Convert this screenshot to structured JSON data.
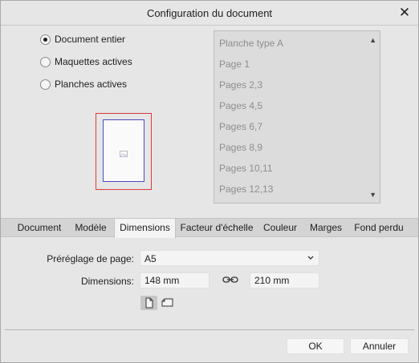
{
  "window": {
    "title": "Configuration du document",
    "close_symbol": "✕"
  },
  "scope": {
    "options": [
      {
        "label": "Document entier",
        "checked": true
      },
      {
        "label": "Maquettes actives",
        "checked": false
      },
      {
        "label": "Planches actives",
        "checked": false
      }
    ]
  },
  "spreads": {
    "items": [
      "Planche type A",
      "Page 1",
      "Pages 2,3",
      "Pages 4,5",
      "Pages 6,7",
      "Pages 8,9",
      "Pages 10,11",
      "Pages 12,13"
    ],
    "scroll_up": "▲",
    "scroll_down": "▼"
  },
  "tabs": {
    "items": [
      "Document",
      "Modèle",
      "Dimensions",
      "Facteur d'échelle",
      "Couleur",
      "Marges",
      "Fond perdu"
    ],
    "active": "Dimensions"
  },
  "dimensions": {
    "preset_label": "Préréglage de page:",
    "preset_value": "A5",
    "size_label": "Dimensions:",
    "width": "148 mm",
    "height": "210 mm"
  },
  "buttons": {
    "ok": "OK",
    "cancel": "Annuler"
  },
  "icons": {
    "close": "close-icon",
    "link": "link-icon",
    "portrait": "portrait-page-icon",
    "landscape": "landscape-page-icon",
    "chevron": "chevron-down-icon"
  }
}
